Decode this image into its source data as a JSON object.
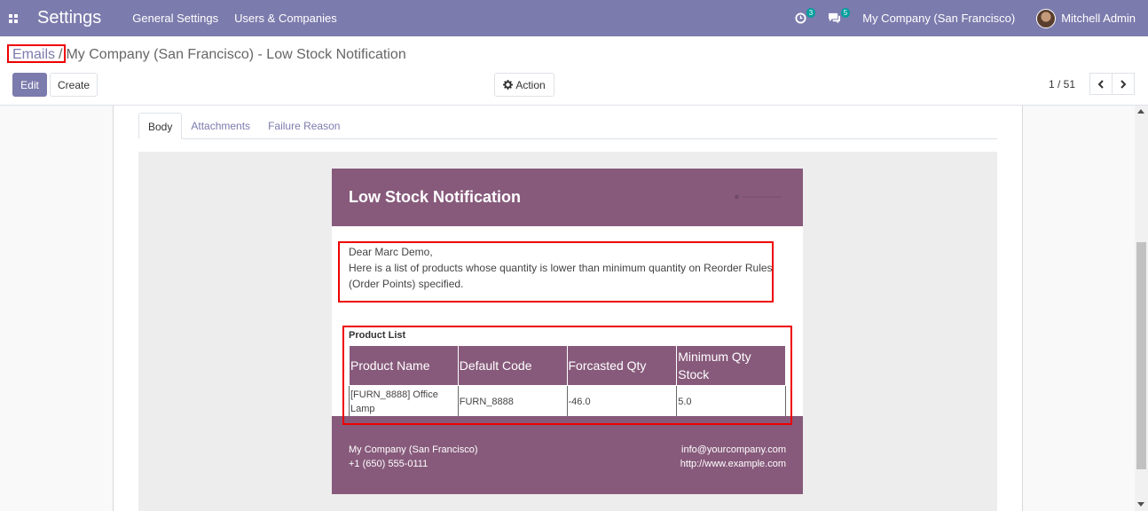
{
  "navbar": {
    "app_title": "Settings",
    "menu": [
      "General Settings",
      "Users & Companies"
    ],
    "activity_badge": "3",
    "messages_badge": "5",
    "company": "My Company (San Francisco)",
    "user": "Mitchell Admin"
  },
  "breadcrumb": {
    "parent": "Emails",
    "separator": "/",
    "current": "My Company (San Francisco) - Low Stock Notification"
  },
  "toolbar": {
    "edit_label": "Edit",
    "create_label": "Create",
    "action_label": "Action",
    "pager": "1 / 51"
  },
  "tabs": [
    "Body",
    "Attachments",
    "Failure Reason"
  ],
  "mail": {
    "title": "Low Stock Notification",
    "greeting": "Dear Marc Demo,",
    "message": "Here is a list of products whose quantity is lower than minimum quantity on Reorder Rules (Order Points) specified.",
    "product_list_title": "Product List",
    "table_headers": [
      "Product Name",
      "Default Code",
      "Forcasted Qty",
      "Minimum Qty Stock"
    ],
    "table_rows": [
      [
        "[FURN_8888] Office Lamp",
        "FURN_8888",
        "-46.0",
        "5.0"
      ]
    ],
    "footer": {
      "company": "My Company (San Francisco)",
      "phone": "+1 (650) 555-0111",
      "email": "info@yourcompany.com",
      "website": "http://www.example.com"
    }
  },
  "colors": {
    "navbar": "#7c7bad",
    "mail_accent": "#875a7b",
    "badge": "#00a09d",
    "highlight": "#ee0000"
  }
}
